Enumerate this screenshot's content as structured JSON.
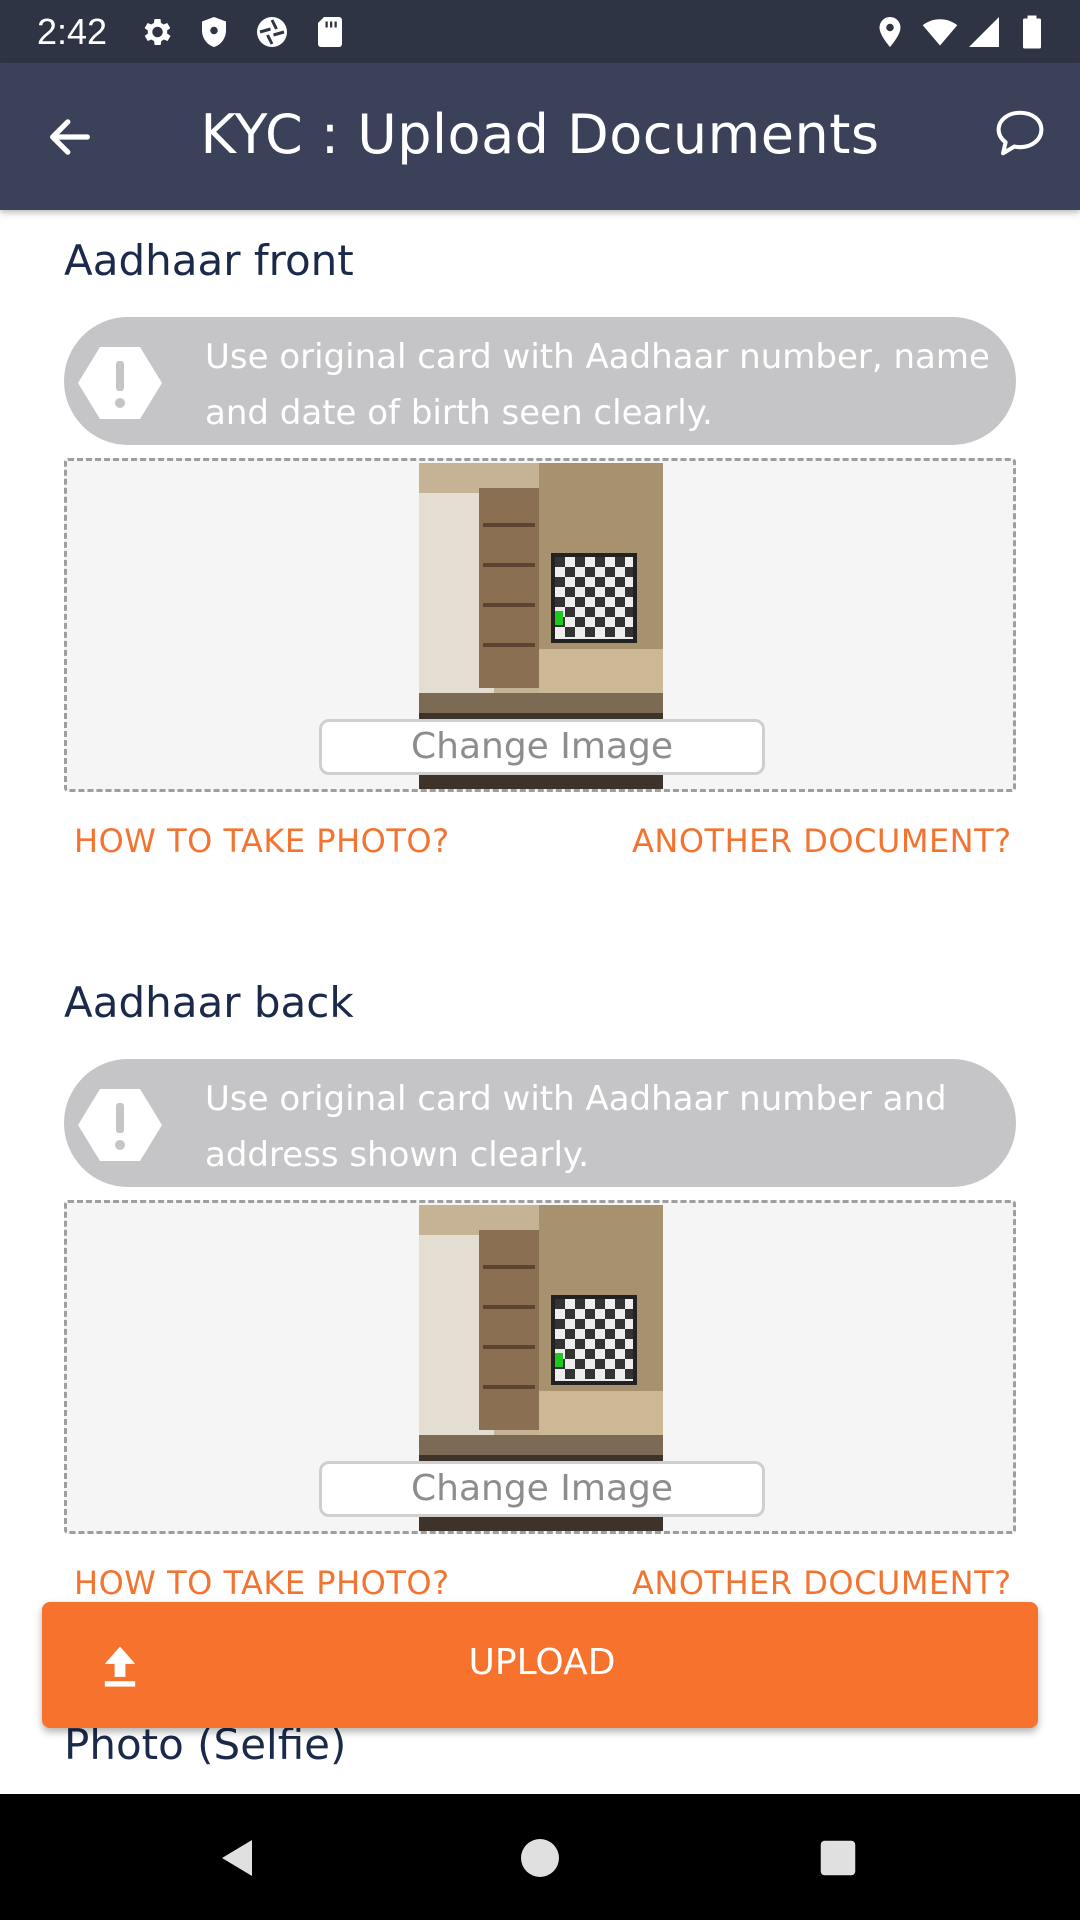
{
  "status_bar": {
    "time": "2:42",
    "left_icons": [
      "settings-icon",
      "shield-icon",
      "camera-shutter-icon",
      "sd-card-icon"
    ],
    "right_icons": [
      "location-icon",
      "wifi-icon",
      "signal-icon",
      "battery-icon"
    ]
  },
  "app_bar": {
    "title": "KYC : Upload Documents",
    "back_icon": "back-arrow-icon",
    "chat_icon": "chat-bubble-icon",
    "background": "#3a4159"
  },
  "sections": [
    {
      "title": "Aadhaar front",
      "info": "Use original card with Aadhaar number, name and date of birth seen clearly.",
      "change_image_label": "Change Image",
      "how_to_label": "HOW TO TAKE PHOTO?",
      "another_doc_label": "ANOTHER DOCUMENT?"
    },
    {
      "title": "Aadhaar back",
      "info": "Use original card with Aadhaar number and address shown clearly.",
      "change_image_label": "Change Image",
      "how_to_label": "HOW TO TAKE PHOTO?",
      "another_doc_label": "ANOTHER DOCUMENT?"
    },
    {
      "title": "Photo (Selfie)"
    }
  ],
  "upload_button": {
    "label": "UPLOAD",
    "icon": "upload-icon",
    "color": "#f7722d"
  },
  "accent_color": "#f37430",
  "nav_bar": {
    "icons": [
      "nav-back-icon",
      "nav-home-icon",
      "nav-recents-icon"
    ]
  }
}
